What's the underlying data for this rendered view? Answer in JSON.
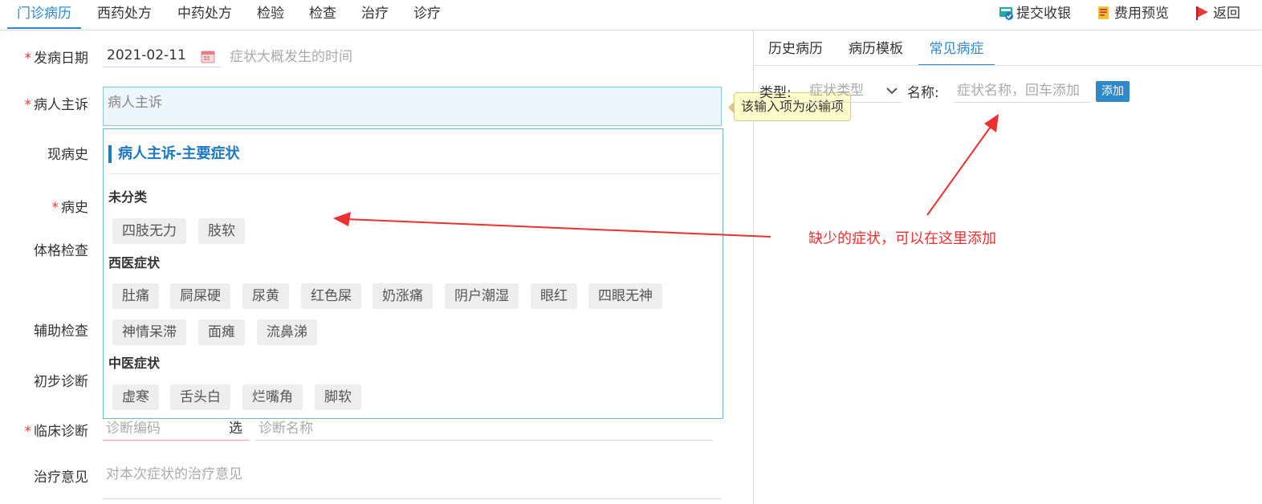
{
  "top_tabs": [
    "门诊病历",
    "西药处方",
    "中药处方",
    "检验",
    "检查",
    "治疗",
    "诊疗"
  ],
  "toolbar": {
    "submit": "提交收银",
    "preview": "费用预览",
    "back": "返回"
  },
  "form": {
    "onset_label": "发病日期",
    "onset_value": "2021-02-11",
    "onset_hint": "症状大概发生的时间",
    "complaint_label": "病人主诉",
    "complaint_placeholder": "病人主诉",
    "required_tip": "该输入项为必输项",
    "present_label": "现病史",
    "history_label": "病史",
    "exam_label": "体格检查",
    "aux_label": "辅助检查",
    "prelim_label": "初步诊断",
    "clinical_label": "临床诊断",
    "diag_code_placeholder": "诊断编码",
    "select_label": "选",
    "diag_name_placeholder": "诊断名称",
    "treatment_label": "治疗意见",
    "treatment_placeholder": "对本次症状的治疗意见"
  },
  "dropdown": {
    "title": "病人主诉-主要症状",
    "groups": [
      {
        "name": "未分类",
        "items": [
          "四肢无力",
          "肢软"
        ]
      },
      {
        "name": "西医症状",
        "items": [
          "肚痛",
          "屙屎硬",
          "尿黄",
          "红色屎",
          "奶涨痛",
          "阴户潮湿",
          "眼红",
          "四眼无神",
          "神情呆滞",
          "面瘫",
          "流鼻涕"
        ]
      },
      {
        "name": "中医症状",
        "items": [
          "虚寒",
          "舌头白",
          "烂嘴角",
          "脚软"
        ]
      }
    ]
  },
  "right_panel": {
    "tabs": [
      "历史病历",
      "病历模板",
      "常见病症"
    ],
    "active_tab": 2,
    "type_label": "类型:",
    "type_placeholder": "症状类型",
    "name_label": "名称:",
    "name_placeholder": "症状名称，回车添加",
    "add_button": "添加"
  },
  "annotation": "缺少的症状，可以在这里添加",
  "colors": {
    "accent": "#2a8ad8",
    "required": "#e53935",
    "annotation": "#ee3030"
  }
}
